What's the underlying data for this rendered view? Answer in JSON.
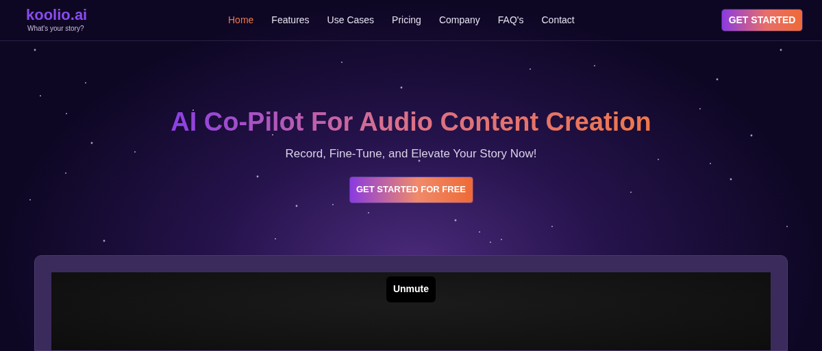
{
  "header": {
    "logo": "koolio.ai",
    "tagline": "What's your story?",
    "nav": [
      {
        "label": "Home",
        "selected": true
      },
      {
        "label": "Features",
        "selected": false
      },
      {
        "label": "Use Cases",
        "selected": false
      },
      {
        "label": "Pricing",
        "selected": false
      },
      {
        "label": "Company",
        "selected": false
      },
      {
        "label": "FAQ's",
        "selected": false
      },
      {
        "label": "Contact",
        "selected": false
      }
    ],
    "cta": "GET STARTED"
  },
  "hero": {
    "title": "AI Co-Pilot For Audio Content Creation",
    "subtitle": "Record, Fine-Tune, and Elevate Your Story Now!",
    "button": "GET STARTED FOR FREE"
  },
  "video": {
    "unmute_button": "Unmute"
  }
}
